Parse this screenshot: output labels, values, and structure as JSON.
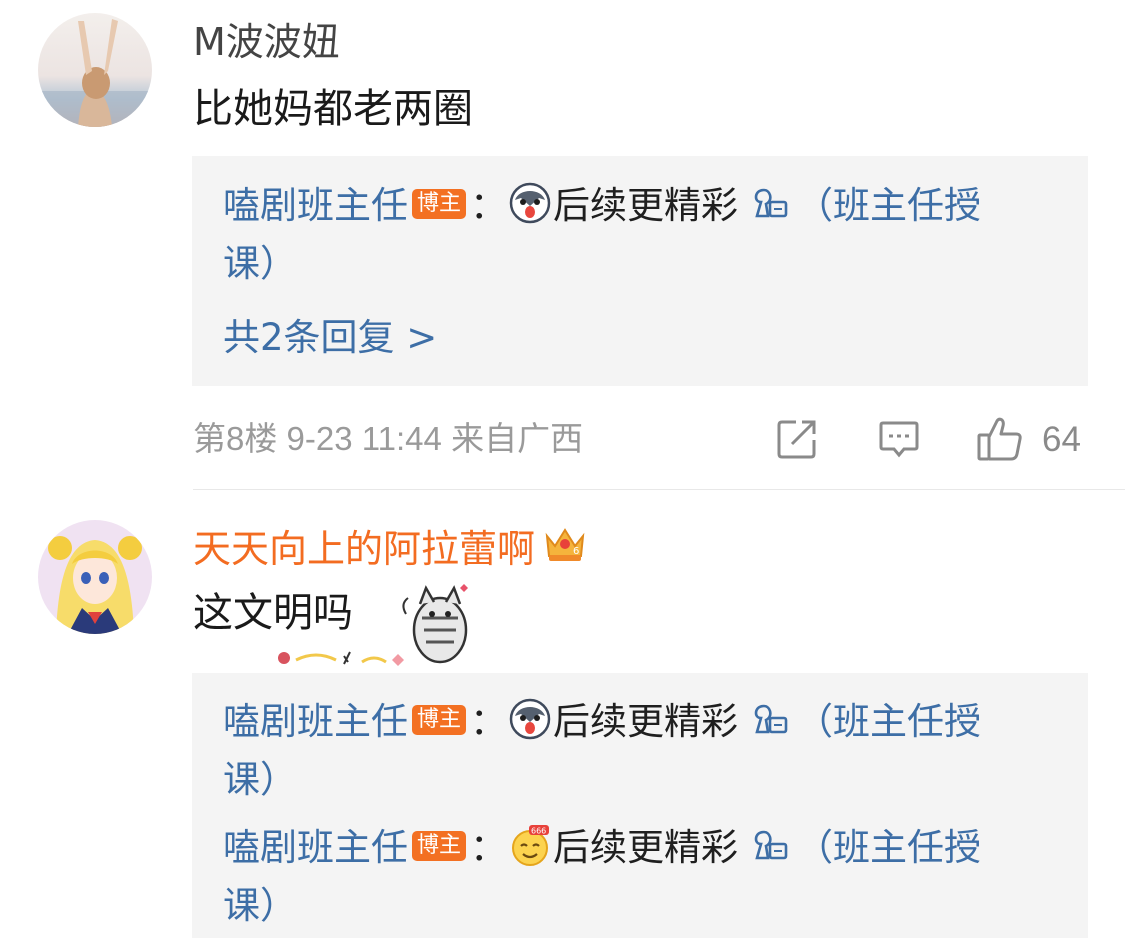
{
  "comments": [
    {
      "username": "M波波妞",
      "text": "比她妈都老两圈",
      "replies": [
        {
          "name": "嗑剧班主任",
          "badge": "博主",
          "sep": "：",
          "text": "后续更精彩",
          "link_text": "（班主任授",
          "link_text2": "课）"
        }
      ],
      "more_replies": "共2条回复 >",
      "floor": "第8楼",
      "date": "9-23 11:44",
      "location": "来自广西",
      "likes": "64"
    },
    {
      "username": "天天向上的阿拉蕾啊",
      "text": "这文明吗",
      "replies": [
        {
          "name": "嗑剧班主任",
          "badge": "博主",
          "sep": "：",
          "text": "后续更精彩",
          "link_text": "（班主任授",
          "link_text2": "课）"
        },
        {
          "name": "嗑剧班主任",
          "badge": "博主",
          "sep": "：",
          "text": "后续更精彩",
          "link_text": "（班主任授",
          "link_text2": "课）"
        }
      ]
    }
  ],
  "icons": {
    "share": "share-icon",
    "comment": "comment-icon",
    "like": "thumbs-up-icon",
    "emoji1": "husky-emoji-icon",
    "emoji2": "666-emoji-icon",
    "link": "link-icon",
    "crown": "crown-badge-icon",
    "sticker": "cat-sticker-icon"
  },
  "colors": {
    "username_orange": "#f36c21",
    "reply_name_blue": "#3d6ea6",
    "badge_orange": "#f37022",
    "reply_bg": "#f4f4f4",
    "meta_gray": "#9a9a9a"
  }
}
